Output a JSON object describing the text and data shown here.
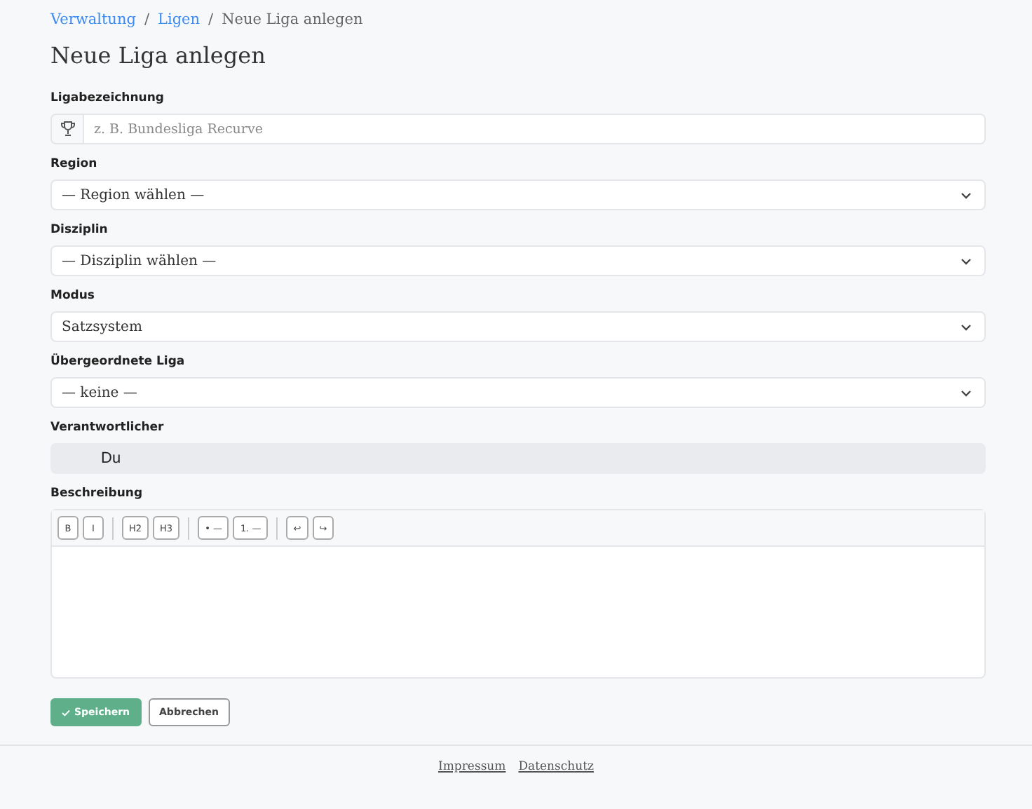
{
  "breadcrumb": [
    {
      "label": "Verwaltung",
      "kind": "link"
    },
    {
      "label": "/",
      "kind": "separator"
    },
    {
      "label": "Ligen",
      "kind": "link"
    },
    {
      "label": "/",
      "kind": "separator"
    },
    {
      "label": "Neue Liga anlegen",
      "kind": "current"
    }
  ],
  "title": "Neue Liga anlegen",
  "fields": [
    {
      "label": "Ligabezeichnung",
      "kind": "text",
      "placeholder": "z. B. Bundesliga Recurve"
    },
    {
      "label": "Region",
      "kind": "select",
      "value": "— Region wählen —"
    },
    {
      "label": "Disziplin",
      "kind": "select",
      "value": "— Disziplin wählen —"
    },
    {
      "label": "Modus",
      "kind": "select",
      "value": "Satzsystem"
    },
    {
      "label": "Übergeordnete Liga",
      "kind": "select",
      "value": "— keine —"
    },
    {
      "label": "Verantwortlicher",
      "kind": "readonly",
      "value": "Du"
    },
    {
      "label": "Beschreibung",
      "kind": "editor",
      "toolbar": [
        [
          "B",
          "I"
        ],
        [
          "H2",
          "H3"
        ],
        [
          "• —",
          "1. —"
        ],
        [
          "↩",
          "↪"
        ]
      ]
    }
  ],
  "buttons": [
    {
      "label": "Speichern",
      "kind": "primary"
    },
    {
      "label": "Abbrechen",
      "kind": "secondary"
    }
  ],
  "footer": [
    "Impressum",
    "Datenschutz"
  ]
}
